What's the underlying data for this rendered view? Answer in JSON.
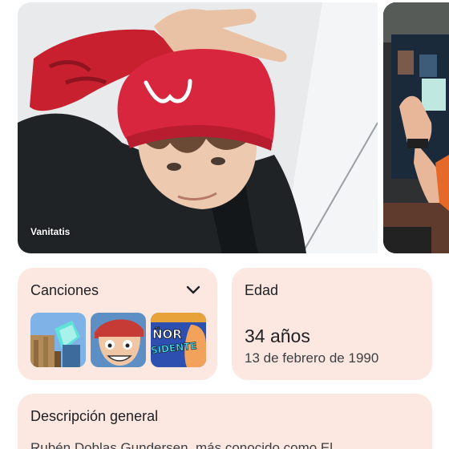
{
  "hero": {
    "credit": "Vanitatis"
  },
  "songs_card": {
    "title": "Canciones",
    "expand_icon": "chevron-down-icon",
    "thumbnails": [
      {
        "icon": "minecraft-thumbnail"
      },
      {
        "icon": "cartoon-face-thumbnail"
      },
      {
        "icon": "señor-presidente-thumbnail",
        "text": "ÑOR\nSIDENTE"
      }
    ]
  },
  "age_card": {
    "title": "Edad",
    "age": "34 años",
    "birth_date": "13 de febrero de 1990"
  },
  "description_card": {
    "title": "Descripción general",
    "text": "Rubén Doblas Gundersen, más conocido como El"
  },
  "colors": {
    "card_bg": "#fde8e1",
    "accent_red": "#d7263d"
  }
}
